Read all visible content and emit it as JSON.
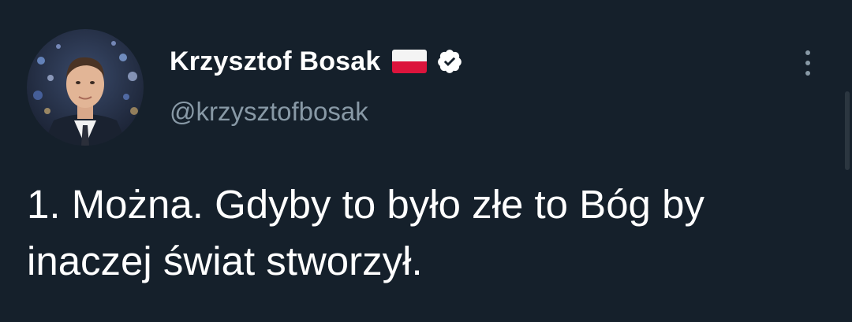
{
  "author": {
    "display_name": "Krzysztof Bosak",
    "handle": "@krzysztofbosak",
    "flag_icon": "poland-flag-icon",
    "verified_icon": "verified-badge-icon"
  },
  "menu": {
    "icon": "more-vertical-icon"
  },
  "tweet": {
    "text": "1. Można. Gdyby to było złe to Bóg by\ninaczej świat stworzył."
  },
  "colors": {
    "background": "#15202b",
    "primary_text": "#ffffff",
    "secondary_text": "#8899a6",
    "flag_white": "#f4f4f4",
    "flag_red": "#dc143c"
  }
}
